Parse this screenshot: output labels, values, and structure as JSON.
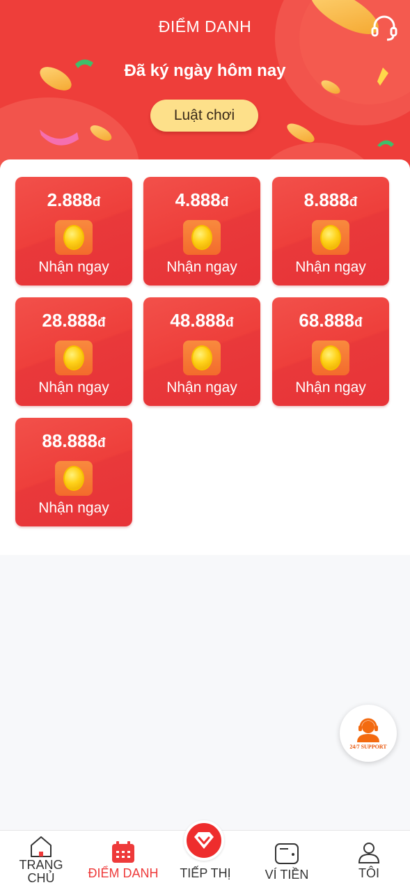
{
  "header": {
    "title": "ĐIỂM DANH",
    "subtitle": "Đã ký ngày hôm nay",
    "rules_button": "Luật chơi",
    "support_icon": "headset-icon"
  },
  "rewards": [
    {
      "amount": "2.888",
      "currency": "đ",
      "action": "Nhận ngay"
    },
    {
      "amount": "4.888",
      "currency": "đ",
      "action": "Nhận ngay"
    },
    {
      "amount": "8.888",
      "currency": "đ",
      "action": "Nhận ngay"
    },
    {
      "amount": "28.888",
      "currency": "đ",
      "action": "Nhận ngay"
    },
    {
      "amount": "48.888",
      "currency": "đ",
      "action": "Nhận ngay"
    },
    {
      "amount": "68.888",
      "currency": "đ",
      "action": "Nhận ngay"
    },
    {
      "amount": "88.888",
      "currency": "đ",
      "action": "Nhận ngay"
    }
  ],
  "support_float": {
    "label": "24/7 SUPPORT"
  },
  "bottom_nav": [
    {
      "label": "TRANG CHỦ",
      "icon": "home-icon",
      "active": false
    },
    {
      "label": "ĐIỂM DANH",
      "icon": "calendar-icon",
      "active": true
    },
    {
      "label": "TIẾP THỊ",
      "icon": "diamond-icon",
      "active": false
    },
    {
      "label": "VÍ TIỀN",
      "icon": "wallet-icon",
      "active": false
    },
    {
      "label": "TÔI",
      "icon": "user-icon",
      "active": false
    }
  ],
  "colors": {
    "primary_red": "#ee3e3a",
    "button_yellow": "#fde08a",
    "coin_gold": "#ffd21a",
    "active_nav": "#ee3a3a"
  }
}
